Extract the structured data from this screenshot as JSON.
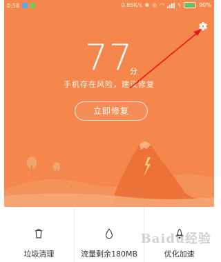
{
  "status_bar": {
    "time": "0:58",
    "network_speed": "0.85K/s",
    "battery_percent": "90%",
    "battery_level": 0.9
  },
  "hero": {
    "score": "77",
    "score_unit": "分",
    "risk_message": "手机存在风险，建议修复",
    "fix_button_label": "立即修复",
    "background_color": "#f5874c"
  },
  "tabs": [
    {
      "label": "垃圾清理",
      "icon": "trash-icon"
    },
    {
      "label": "流量剩余180MB",
      "icon": "water-drop-icon"
    },
    {
      "label": "优化加速",
      "icon": "rocket-icon"
    }
  ],
  "annotation": {
    "arrow_color": "#e8161b",
    "target": "settings-icon"
  },
  "watermark": {
    "text": "Baidu经验"
  }
}
